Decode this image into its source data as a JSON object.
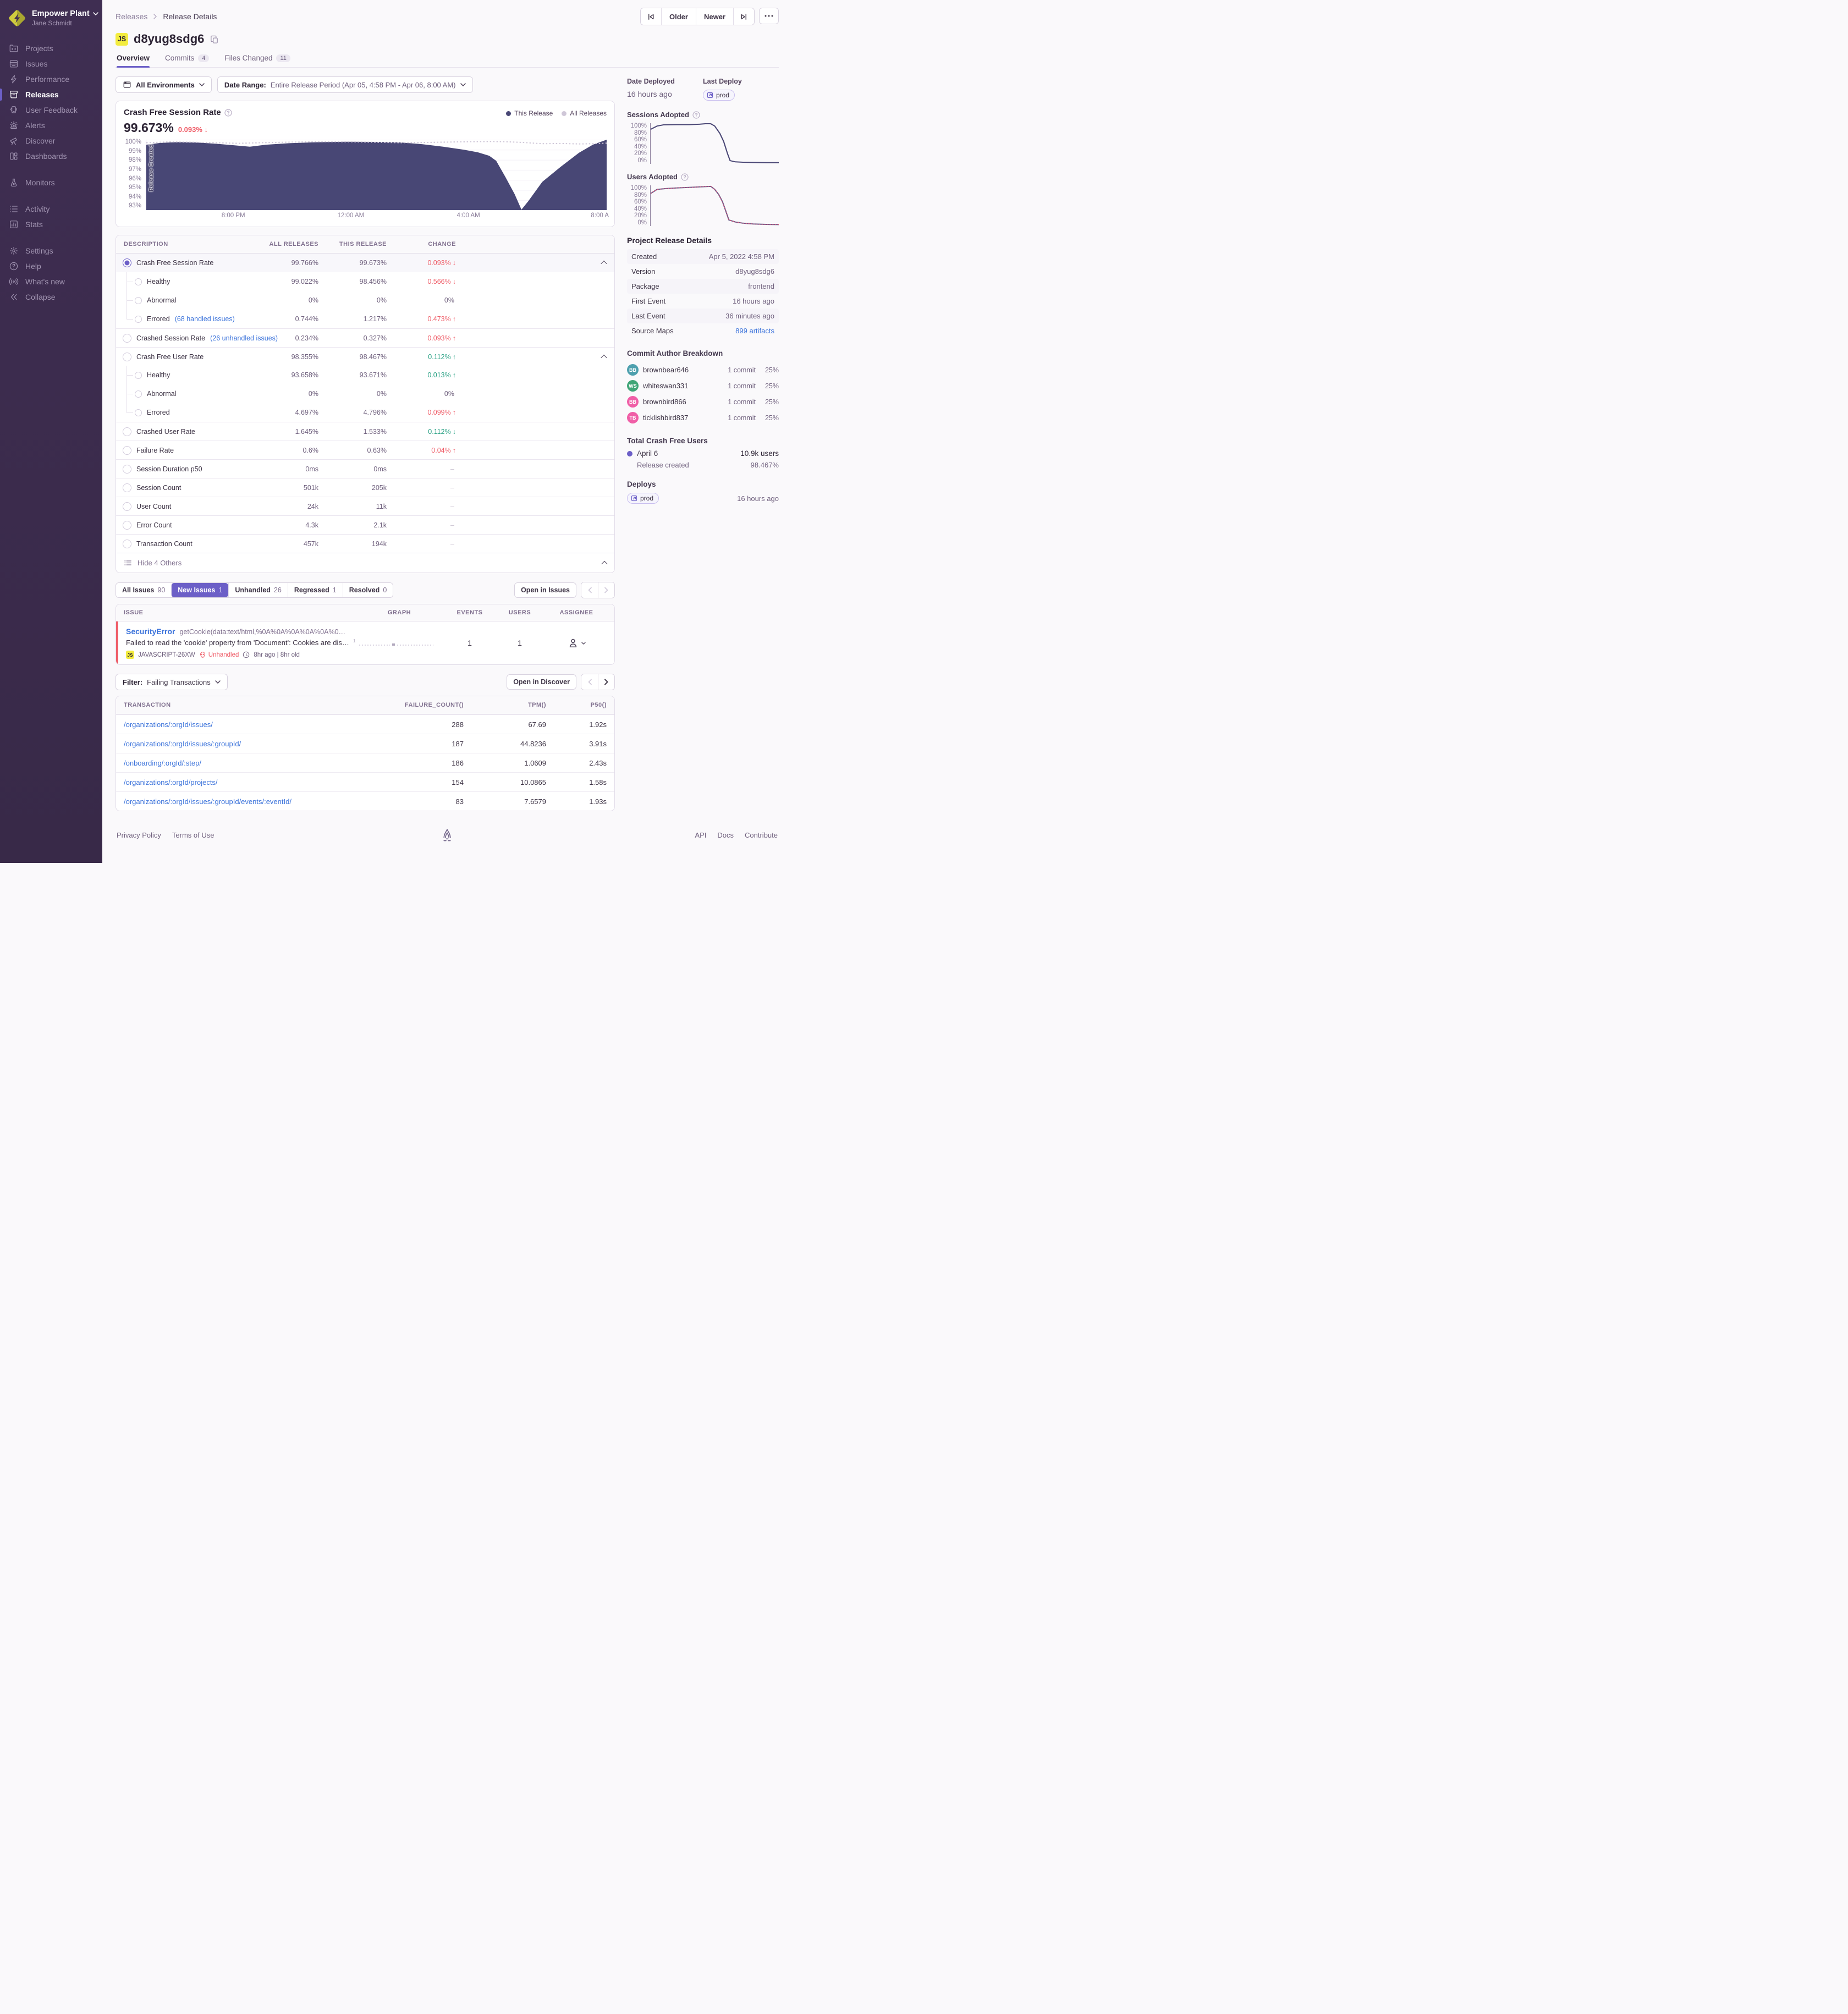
{
  "app": {
    "org_name": "Empower Plant",
    "user_name": "Jane Schmidt"
  },
  "sidebar": {
    "items": [
      {
        "label": "Projects"
      },
      {
        "label": "Issues"
      },
      {
        "label": "Performance"
      },
      {
        "label": "Releases"
      },
      {
        "label": "User Feedback"
      },
      {
        "label": "Alerts"
      },
      {
        "label": "Discover"
      },
      {
        "label": "Dashboards"
      },
      {
        "label": "Monitors"
      },
      {
        "label": "Activity"
      },
      {
        "label": "Stats"
      },
      {
        "label": "Settings"
      },
      {
        "label": "Help"
      },
      {
        "label": "What's new"
      },
      {
        "label": "Collapse"
      }
    ]
  },
  "header": {
    "breadcrumb": [
      "Releases",
      "Release Details"
    ],
    "older": "Older",
    "newer": "Newer"
  },
  "release": {
    "badge": "JS",
    "version": "d8yug8sdg6",
    "tabs": [
      {
        "label": "Overview"
      },
      {
        "label": "Commits",
        "count": "4"
      },
      {
        "label": "Files Changed",
        "count": "11"
      }
    ]
  },
  "filters": {
    "environment": "All Environments",
    "date_label": "Date Range:",
    "date_value": "Entire Release Period (Apr 05, 4:58 PM - Apr 06, 8:00 AM)"
  },
  "summary": {
    "title": "Crash Free Session Rate",
    "value": "99.673%",
    "change": "0.093%",
    "arrow": "↓"
  },
  "chart_data": {
    "type": "area",
    "title": "Crash Free Session Rate",
    "ylim": [
      93,
      100
    ],
    "y_ticks": [
      "100%",
      "99%",
      "98%",
      "97%",
      "96%",
      "95%",
      "94%",
      "93%"
    ],
    "x_ticks": [
      "8:00 PM",
      "12:00 AM",
      "4:00 AM",
      "8:00 A"
    ],
    "legend": [
      "This Release",
      "All Releases"
    ],
    "annotation": "Release Created",
    "this_release": [
      [
        0,
        99.5
      ],
      [
        0.03,
        99.68
      ],
      [
        0.07,
        99.76
      ],
      [
        0.11,
        99.72
      ],
      [
        0.15,
        99.6
      ],
      [
        0.19,
        99.45
      ],
      [
        0.225,
        99.3
      ],
      [
        0.26,
        99.5
      ],
      [
        0.31,
        99.65
      ],
      [
        0.37,
        99.75
      ],
      [
        0.43,
        99.8
      ],
      [
        0.5,
        99.78
      ],
      [
        0.55,
        99.73
      ],
      [
        0.6,
        99.55
      ],
      [
        0.645,
        99.3
      ],
      [
        0.69,
        99.0
      ],
      [
        0.72,
        98.75
      ],
      [
        0.745,
        98.4
      ],
      [
        0.76,
        97.9
      ],
      [
        0.78,
        96.3
      ],
      [
        0.8,
        94.6
      ],
      [
        0.815,
        93.05
      ],
      [
        0.83,
        93.9
      ],
      [
        0.86,
        95.8
      ],
      [
        0.9,
        97.3
      ],
      [
        0.94,
        98.7
      ],
      [
        0.97,
        99.5
      ],
      [
        1,
        100
      ]
    ],
    "all_releases": [
      [
        0,
        99.7
      ],
      [
        0.05,
        99.78
      ],
      [
        0.1,
        99.75
      ],
      [
        0.15,
        99.7
      ],
      [
        0.2,
        99.64
      ],
      [
        0.25,
        99.7
      ],
      [
        0.3,
        99.75
      ],
      [
        0.35,
        99.78
      ],
      [
        0.4,
        99.8
      ],
      [
        0.45,
        99.78
      ],
      [
        0.5,
        99.74
      ],
      [
        0.55,
        99.7
      ],
      [
        0.6,
        99.72
      ],
      [
        0.65,
        99.76
      ],
      [
        0.7,
        99.8
      ],
      [
        0.75,
        99.82
      ],
      [
        0.78,
        99.8
      ],
      [
        0.82,
        99.72
      ],
      [
        0.86,
        99.6
      ],
      [
        0.9,
        99.62
      ],
      [
        0.94,
        99.58
      ],
      [
        0.97,
        99.6
      ],
      [
        1,
        99.66
      ]
    ],
    "sessions_adopted": [
      [
        0,
        85
      ],
      [
        0.05,
        93
      ],
      [
        0.1,
        96
      ],
      [
        0.2,
        96.5
      ],
      [
        0.3,
        96.5
      ],
      [
        0.38,
        97.5
      ],
      [
        0.44,
        99
      ],
      [
        0.47,
        98.5
      ],
      [
        0.5,
        93
      ],
      [
        0.54,
        75
      ],
      [
        0.57,
        55
      ],
      [
        0.6,
        25
      ],
      [
        0.62,
        8
      ],
      [
        0.66,
        5
      ],
      [
        0.72,
        4
      ],
      [
        0.8,
        3.5
      ],
      [
        0.9,
        3
      ],
      [
        1,
        3
      ]
    ],
    "users_adopted": [
      [
        0,
        80
      ],
      [
        0.05,
        90
      ],
      [
        0.12,
        92
      ],
      [
        0.2,
        93.5
      ],
      [
        0.3,
        95
      ],
      [
        0.4,
        96.5
      ],
      [
        0.47,
        97.5
      ],
      [
        0.5,
        90
      ],
      [
        0.53,
        78
      ],
      [
        0.56,
        60
      ],
      [
        0.585,
        38
      ],
      [
        0.61,
        15
      ],
      [
        0.66,
        10
      ],
      [
        0.72,
        7
      ],
      [
        0.8,
        5
      ],
      [
        0.9,
        4
      ],
      [
        1,
        3.5
      ]
    ]
  },
  "metrics": {
    "headers": [
      "DESCRIPTION",
      "ALL RELEASES",
      "THIS RELEASE",
      "CHANGE"
    ],
    "rows": [
      {
        "label": "Crash Free Session Rate",
        "all": "99.766%",
        "this": "99.673%",
        "change": "0.093%",
        "arrow": "↓",
        "tone": "red",
        "radio": "on",
        "chev": "1",
        "sel": "1"
      },
      {
        "label": "Healthy",
        "all": "99.022%",
        "this": "98.456%",
        "change": "0.566%",
        "arrow": "↓",
        "tone": "red",
        "radio": "sub",
        "indent": "mid"
      },
      {
        "label": "Abnormal",
        "all": "0%",
        "this": "0%",
        "change": "0%",
        "tone": "mut",
        "radio": "sub",
        "indent": "mid"
      },
      {
        "label": "Errored",
        "link": "(68 handled issues)",
        "all": "0.744%",
        "this": "1.217%",
        "change": "0.473%",
        "arrow": "↑",
        "tone": "red",
        "radio": "sub",
        "indent": "last"
      },
      {
        "label": "Crashed Session Rate",
        "link": "(26 unhandled issues)",
        "all": "0.234%",
        "this": "0.327%",
        "change": "0.093%",
        "arrow": "↑",
        "tone": "red",
        "radio": "off",
        "sep": "1"
      },
      {
        "label": "Crash Free User Rate",
        "all": "98.355%",
        "this": "98.467%",
        "change": "0.112%",
        "arrow": "↑",
        "tone": "green",
        "radio": "off",
        "chev": "1",
        "sep": "1"
      },
      {
        "label": "Healthy",
        "all": "93.658%",
        "this": "93.671%",
        "change": "0.013%",
        "arrow": "↑",
        "tone": "green",
        "radio": "sub",
        "indent": "mid"
      },
      {
        "label": "Abnormal",
        "all": "0%",
        "this": "0%",
        "change": "0%",
        "tone": "mut",
        "radio": "sub",
        "indent": "mid"
      },
      {
        "label": "Errored",
        "all": "4.697%",
        "this": "4.796%",
        "change": "0.099%",
        "arrow": "↑",
        "tone": "red",
        "radio": "sub",
        "indent": "last"
      },
      {
        "label": "Crashed User Rate",
        "all": "1.645%",
        "this": "1.533%",
        "change": "0.112%",
        "arrow": "↓",
        "tone": "green",
        "radio": "off",
        "sep": "1"
      },
      {
        "label": "Failure Rate",
        "all": "0.6%",
        "this": "0.63%",
        "change": "0.04%",
        "arrow": "↑",
        "tone": "red",
        "radio": "off",
        "sep": "1"
      },
      {
        "label": "Session Duration p50",
        "all": "0ms",
        "this": "0ms",
        "change": "–",
        "tone": "dash",
        "radio": "off",
        "sep": "1"
      },
      {
        "label": "Session Count",
        "all": "501k",
        "this": "205k",
        "change": "–",
        "tone": "dash",
        "radio": "off",
        "sep": "1"
      },
      {
        "label": "User Count",
        "all": "24k",
        "this": "11k",
        "change": "–",
        "tone": "dash",
        "radio": "off",
        "sep": "1"
      },
      {
        "label": "Error Count",
        "all": "4.3k",
        "this": "2.1k",
        "change": "–",
        "tone": "dash",
        "radio": "off",
        "sep": "1"
      },
      {
        "label": "Transaction Count",
        "all": "457k",
        "this": "194k",
        "change": "–",
        "tone": "dash",
        "radio": "off",
        "sep": "1"
      }
    ],
    "footer_label": "Hide 4 Others"
  },
  "issues": {
    "tabs": [
      {
        "label": "All Issues",
        "count": "90"
      },
      {
        "label": "New Issues",
        "count": "1",
        "active": "1"
      },
      {
        "label": "Unhandled",
        "count": "26"
      },
      {
        "label": "Regressed",
        "count": "1"
      },
      {
        "label": "Resolved",
        "count": "0"
      }
    ],
    "open_label": "Open in Issues",
    "headers": [
      "ISSUE",
      "GRAPH",
      "EVENTS",
      "USERS",
      "ASSIGNEE"
    ],
    "row": {
      "type": "SecurityError",
      "culprit": "getCookie(data:text/html,%0A%0A%0A%0A%0A%0…",
      "message": "Failed to read the 'cookie' property from 'Document': Cookies are disa…",
      "badge": "JS",
      "short_id": "JAVASCRIPT-26XW",
      "unhandled": "Unhandled",
      "age": "8hr ago | 8hr old",
      "graph_label": "1",
      "events": "1",
      "users": "1"
    }
  },
  "transactions": {
    "filter_label": "Filter:",
    "filter_value": "Failing Transactions",
    "open_label": "Open in Discover",
    "headers": [
      "TRANSACTION",
      "FAILURE_COUNT()",
      "TPM()",
      "P50()"
    ],
    "rows": [
      {
        "name": "/organizations/:orgId/issues/",
        "count": "288",
        "tpm": "67.69",
        "p50": "1.92s"
      },
      {
        "name": "/organizations/:orgId/issues/:groupId/",
        "count": "187",
        "tpm": "44.8236",
        "p50": "3.91s"
      },
      {
        "name": "/onboarding/:orgId/:step/",
        "count": "186",
        "tpm": "1.0609",
        "p50": "2.43s"
      },
      {
        "name": "/organizations/:orgId/projects/",
        "count": "154",
        "tpm": "10.0865",
        "p50": "1.58s"
      },
      {
        "name": "/organizations/:orgId/issues/:groupId/events/:eventId/",
        "count": "83",
        "tpm": "7.6579",
        "p50": "1.93s"
      }
    ]
  },
  "right": {
    "date_deployed": {
      "label": "Date Deployed",
      "value": "16 hours ago"
    },
    "last_deploy": {
      "label": "Last Deploy",
      "badge": "prod"
    },
    "sessions_title": "Sessions Adopted",
    "users_title": "Users Adopted",
    "axis": [
      "100%",
      "80%",
      "60%",
      "40%",
      "20%",
      "0%"
    ],
    "details": {
      "title": "Project Release Details",
      "rows": [
        {
          "label": "Created",
          "value": "Apr 5, 2022 4:58 PM"
        },
        {
          "label": "Version",
          "value": "d8yug8sdg6"
        },
        {
          "label": "Package",
          "value": "frontend"
        },
        {
          "label": "First Event",
          "value": "16 hours ago"
        },
        {
          "label": "Last Event",
          "value": "36 minutes ago"
        },
        {
          "label": "Source Maps",
          "value": "899 artifacts",
          "link": "1"
        }
      ]
    },
    "commits": {
      "title": "Commit Author Breakdown",
      "authors": [
        {
          "initials": "BB",
          "style": "--c:#4EA0AE",
          "color": "#4EA0AE",
          "name": "brownbear646",
          "commits": "1 commit",
          "pct": "25%"
        },
        {
          "initials": "WS",
          "style": "--c:#3FA577",
          "color": "#3FA577",
          "name": "whiteswan331",
          "commits": "1 commit",
          "pct": "25%"
        },
        {
          "initials": "BB",
          "style": "--c:#F05FA7",
          "color": "#F05FA7",
          "name": "brownbird866",
          "commits": "1 commit",
          "pct": "25%"
        },
        {
          "initials": "TB",
          "style": "--c:#F05FA7",
          "color": "#F05FA7",
          "name": "ticklishbird837",
          "commits": "1 commit",
          "pct": "25%"
        }
      ]
    },
    "crash_free": {
      "title": "Total Crash Free Users",
      "date_label": "April 6",
      "date_value": "10.9k users",
      "sub_label": "Release created",
      "sub_value": "98.467%"
    },
    "deploys": {
      "title": "Deploys",
      "badge": "prod",
      "time": "16 hours ago"
    }
  },
  "footer": {
    "left": [
      "Privacy Policy",
      "Terms of Use"
    ],
    "right": [
      "API",
      "Docs",
      "Contribute"
    ]
  },
  "colors": {
    "accent": "#6C5FC7",
    "chart_navy": "#484775",
    "chart_light": "#CFC7D8",
    "red": "#EF5E69",
    "green": "#27A083",
    "link": "#3D74DB",
    "badge_yellow": "#F3EC3F"
  }
}
